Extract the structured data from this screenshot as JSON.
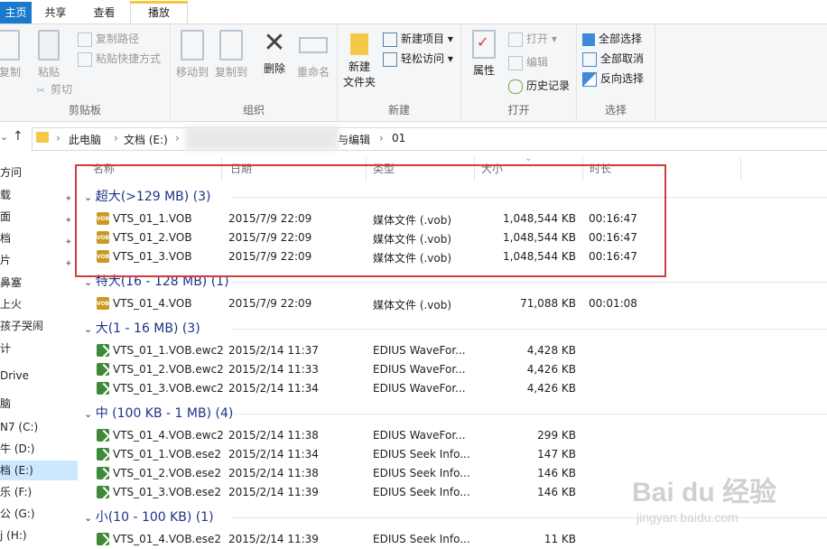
{
  "tabs": {
    "file": "主页",
    "share": "共享",
    "view": "查看",
    "play": "播放"
  },
  "ribbon": {
    "clipboard": {
      "copy": "复制",
      "paste": "粘贴",
      "copy_path": "复制路径",
      "paste_shortcut": "粘贴快捷方式",
      "cut": "剪切",
      "label": "剪贴板"
    },
    "organize": {
      "move_to": "移动到",
      "copy_to": "复制到",
      "delete": "删除",
      "rename": "重命名",
      "label": "组织"
    },
    "new": {
      "new_folder": "新建\n文件夹",
      "new_folder_l1": "新建",
      "new_folder_l2": "文件夹",
      "new_item": "新建项目",
      "easy_access": "轻松访问",
      "label": "新建"
    },
    "open": {
      "properties": "属性",
      "open": "打开",
      "edit": "编辑",
      "history": "历史记录",
      "label": "打开"
    },
    "select": {
      "select_all": "全部选择",
      "select_none": "全部取消",
      "invert": "反向选择",
      "label": "选择"
    }
  },
  "address": {
    "crumbs": [
      "此电脑",
      "文档 (E:)",
      "与编辑",
      "01"
    ]
  },
  "sidebar": {
    "items": [
      {
        "label": "方问",
        "pinned": false
      },
      {
        "label": "载",
        "pinned": true
      },
      {
        "label": "面",
        "pinned": true
      },
      {
        "label": "档",
        "pinned": true
      },
      {
        "label": "片",
        "pinned": true
      },
      {
        "label": "鼻塞",
        "pinned": false
      },
      {
        "label": "上火",
        "pinned": false
      },
      {
        "label": "孩子哭闹",
        "pinned": false
      },
      {
        "label": "计",
        "pinned": false
      },
      {
        "label": "Drive",
        "pinned": false
      },
      {
        "label": "脑",
        "pinned": false
      },
      {
        "label": "N7 (C:)",
        "pinned": false
      },
      {
        "label": "牛 (D:)",
        "pinned": false
      },
      {
        "label": "档 (E:)",
        "pinned": false,
        "selected": true
      },
      {
        "label": "乐 (F:)",
        "pinned": false
      },
      {
        "label": "公 (G:)",
        "pinned": false
      },
      {
        "label": "j (H:)",
        "pinned": false
      }
    ]
  },
  "columns": {
    "name": "名称",
    "date": "日期",
    "type": "类型",
    "size": "大小",
    "length": "时长"
  },
  "groups": [
    {
      "title": "超大(>129 MB) (3)",
      "files": [
        {
          "name": "VTS_01_1.VOB",
          "date": "2015/7/9 22:09",
          "type": "媒体文件 (.vob)",
          "size": "1,048,544 KB",
          "length": "00:16:47",
          "icon": "vob"
        },
        {
          "name": "VTS_01_2.VOB",
          "date": "2015/7/9 22:09",
          "type": "媒体文件 (.vob)",
          "size": "1,048,544 KB",
          "length": "00:16:47",
          "icon": "vob"
        },
        {
          "name": "VTS_01_3.VOB",
          "date": "2015/7/9 22:09",
          "type": "媒体文件 (.vob)",
          "size": "1,048,544 KB",
          "length": "00:16:47",
          "icon": "vob"
        }
      ]
    },
    {
      "title": "特大(16 - 128 MB) (1)",
      "files": [
        {
          "name": "VTS_01_4.VOB",
          "date": "2015/7/9 22:09",
          "type": "媒体文件 (.vob)",
          "size": "71,088 KB",
          "length": "00:01:08",
          "icon": "vob"
        }
      ]
    },
    {
      "title": "大(1 - 16 MB) (3)",
      "files": [
        {
          "name": "VTS_01_1.VOB.ewc2",
          "date": "2015/2/14 11:37",
          "type": "EDIUS WaveFor...",
          "size": "4,428 KB",
          "length": "",
          "icon": "ewc"
        },
        {
          "name": "VTS_01_2.VOB.ewc2",
          "date": "2015/2/14 11:33",
          "type": "EDIUS WaveFor...",
          "size": "4,426 KB",
          "length": "",
          "icon": "ewc"
        },
        {
          "name": "VTS_01_3.VOB.ewc2",
          "date": "2015/2/14 11:34",
          "type": "EDIUS WaveFor...",
          "size": "4,426 KB",
          "length": "",
          "icon": "ewc"
        }
      ]
    },
    {
      "title": "中 (100 KB - 1 MB) (4)",
      "files": [
        {
          "name": "VTS_01_4.VOB.ewc2",
          "date": "2015/2/14 11:38",
          "type": "EDIUS WaveFor...",
          "size": "299 KB",
          "length": "",
          "icon": "ewc"
        },
        {
          "name": "VTS_01_1.VOB.ese2",
          "date": "2015/2/14 11:34",
          "type": "EDIUS Seek Info...",
          "size": "147 KB",
          "length": "",
          "icon": "ewc"
        },
        {
          "name": "VTS_01_2.VOB.ese2",
          "date": "2015/2/14 11:38",
          "type": "EDIUS Seek Info...",
          "size": "146 KB",
          "length": "",
          "icon": "ewc"
        },
        {
          "name": "VTS_01_3.VOB.ese2",
          "date": "2015/2/14 11:39",
          "type": "EDIUS Seek Info...",
          "size": "146 KB",
          "length": "",
          "icon": "ewc"
        }
      ]
    },
    {
      "title": "小(10 - 100 KB) (1)",
      "files": [
        {
          "name": "VTS_01_4.VOB.ese2",
          "date": "2015/2/14 11:39",
          "type": "EDIUS Seek Info...",
          "size": "11 KB",
          "length": "",
          "icon": "ewc"
        }
      ]
    }
  ],
  "watermark": {
    "main": "Bai du 经验",
    "sub": "jingyan.baidu.com"
  },
  "colors": {
    "file_tab": "#1979ca",
    "group_header": "#1e3287",
    "selection": "#cce8ff",
    "highlight_box": "#d23b3b",
    "accent_tab": "#f4c83c"
  }
}
